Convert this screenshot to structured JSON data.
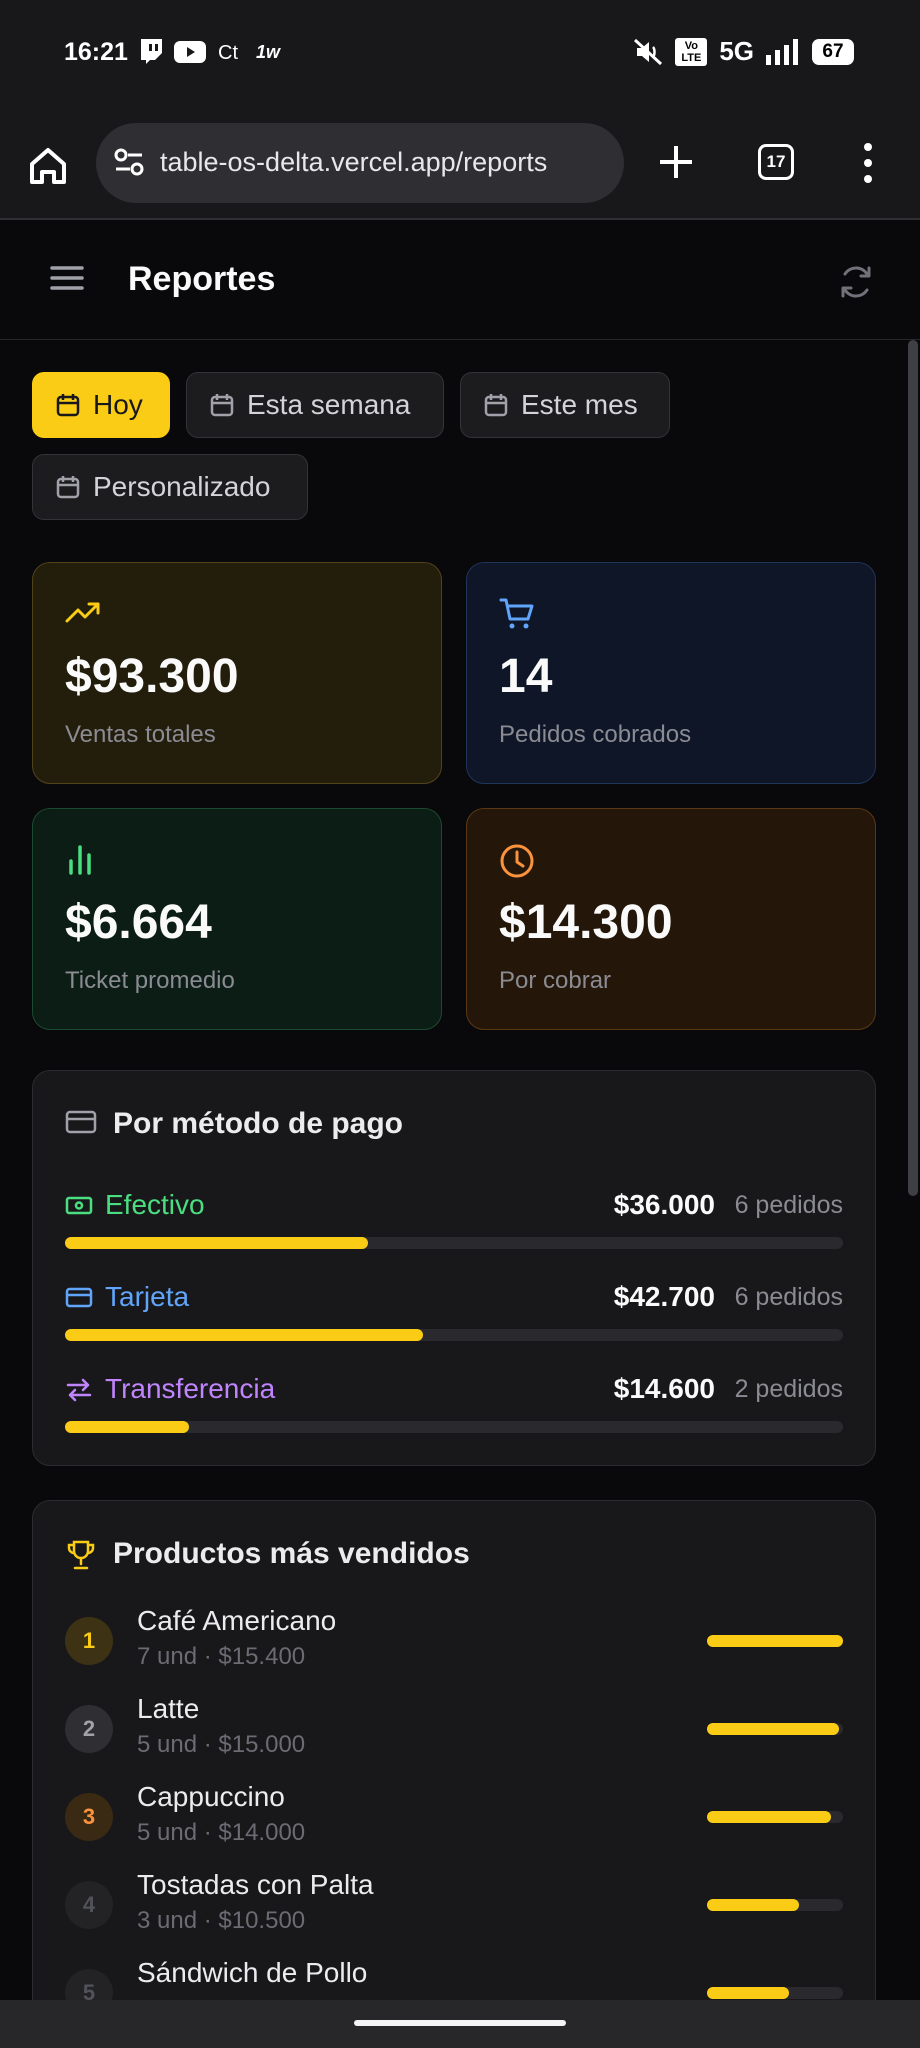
{
  "status_bar": {
    "time": "16:21",
    "network": "5G",
    "volte": "Vo LTE",
    "battery": "67",
    "apps": [
      "twitch-icon",
      "youtube-icon",
      "ct-icon",
      "1w-icon"
    ]
  },
  "browser": {
    "url": "table-os-delta.vercel.app/reports",
    "tab_count": "17"
  },
  "header": {
    "title": "Reportes"
  },
  "filters": [
    {
      "label": "Hoy",
      "active": true
    },
    {
      "label": "Esta semana",
      "active": false
    },
    {
      "label": "Este mes",
      "active": false
    },
    {
      "label": "Personalizado",
      "active": false
    }
  ],
  "stats": {
    "sales": {
      "value": "$93.300",
      "label": "Ventas totales",
      "icon": "trending-up-icon",
      "color": "#facc15"
    },
    "orders": {
      "value": "14",
      "label": "Pedidos cobrados",
      "icon": "cart-icon",
      "color": "#60a5fa"
    },
    "ticket": {
      "value": "$6.664",
      "label": "Ticket promedio",
      "icon": "bar-chart-icon",
      "color": "#4ade80"
    },
    "pending": {
      "value": "$14.300",
      "label": "Por cobrar",
      "icon": "clock-icon",
      "color": "#fb923c"
    }
  },
  "payment_methods": {
    "title": "Por método de pago",
    "items": [
      {
        "name": "Efectivo",
        "amount": "$36.000",
        "count": "6 pedidos",
        "share": 0.39,
        "color": "#4ade80",
        "icon": "cash-icon"
      },
      {
        "name": "Tarjeta",
        "amount": "$42.700",
        "count": "6 pedidos",
        "share": 0.46,
        "color": "#60a5fa",
        "icon": "card-icon"
      },
      {
        "name": "Transferencia",
        "amount": "$14.600",
        "count": "2 pedidos",
        "share": 0.16,
        "color": "#c084fc",
        "icon": "transfer-icon"
      }
    ]
  },
  "top_products": {
    "title": "Productos más vendidos",
    "items": [
      {
        "rank": "1",
        "name": "Café Americano",
        "meta": "7 und · $15.400",
        "share": 1.0
      },
      {
        "rank": "2",
        "name": "Latte",
        "meta": "5 und · $15.000",
        "share": 0.97
      },
      {
        "rank": "3",
        "name": "Cappuccino",
        "meta": "5 und · $14.000",
        "share": 0.91
      },
      {
        "rank": "4",
        "name": "Tostadas con Palta",
        "meta": "3 und · $10.500",
        "share": 0.68
      },
      {
        "rank": "5",
        "name": "Sándwich de Pollo",
        "meta": "",
        "share": 0.6
      }
    ]
  }
}
